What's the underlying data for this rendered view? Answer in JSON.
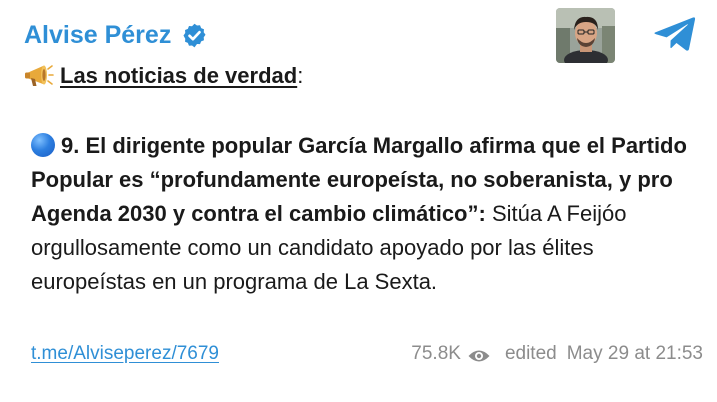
{
  "channel": {
    "name": "Alvise Pérez",
    "verified_icon": "verified-badge-icon",
    "accent_color": "#2f8fd6"
  },
  "header": {
    "megaphone_icon": "megaphone-icon",
    "headline": "Las noticias de verdad",
    "headline_suffix": ":",
    "telegram_icon": "telegram-icon"
  },
  "message": {
    "bullet_icon": "blue-circle-icon",
    "bold_part": "9. El dirigente popular García Margallo afirma que el Partido Popular es “profundamente europeísta, no soberanista, y pro Agenda 2030 y contra el cambio climático”:",
    "normal_part": " Sitúa A Feijóo orgullosamente como un candidato apoyado por las élites europeístas en un programa de La Sexta."
  },
  "footer": {
    "link": "t.me/Alviseperez/7679",
    "views": "75.8K",
    "views_icon": "eye-icon",
    "edited": "edited",
    "date": "May 29 at 21:53"
  }
}
